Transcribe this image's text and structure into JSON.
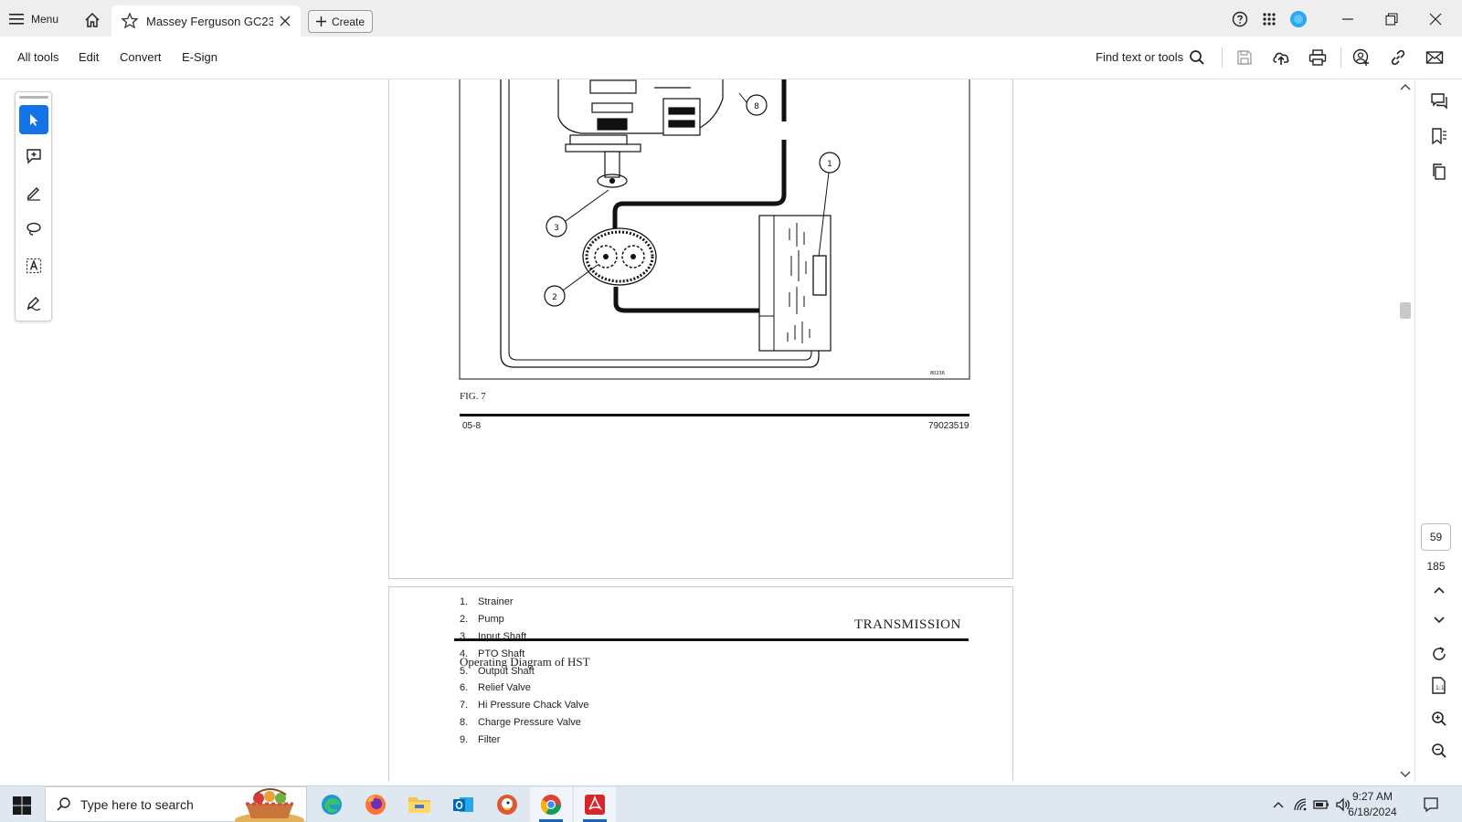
{
  "tabbar": {
    "menu_label": "Menu",
    "tab_title": "Massey Ferguson GC23...",
    "create_label": "Create"
  },
  "toolbar": {
    "menu_items": [
      "All tools",
      "Edit",
      "Convert",
      "E-Sign"
    ],
    "find_label": "Find text or tools"
  },
  "document": {
    "figure_caption": "FIG. 7",
    "fig_code": "80236",
    "page_left_footer": "05-8",
    "page_right_footer": "79023519",
    "diagram_callouts": [
      "8",
      "1",
      "3",
      "2"
    ],
    "section_title": "TRANSMISSION",
    "subtitle": "Operating Diagram of HST",
    "legend": [
      {
        "num": "1.",
        "label": "Strainer"
      },
      {
        "num": "2.",
        "label": "Pump"
      },
      {
        "num": "3.",
        "label": "Input Shaft"
      },
      {
        "num": "4.",
        "label": "PTO Shaft"
      },
      {
        "num": "5.",
        "label": "Output Shaft"
      },
      {
        "num": "6.",
        "label": "Relief Valve"
      },
      {
        "num": "7.",
        "label": "Hi Pressure Chack Valve"
      },
      {
        "num": "8.",
        "label": "Charge Pressure Valve"
      },
      {
        "num": "9.",
        "label": "Filter"
      }
    ]
  },
  "navigation": {
    "current_page": "59",
    "total_pages": "185"
  },
  "taskbar": {
    "search_placeholder": "Type here to search",
    "time": "9:27 AM",
    "date": "6/18/2024"
  },
  "colors": {
    "accent": "#1473e6",
    "taskbar_bg": "#dfe8f1",
    "tabbar_bg": "#eeeeee"
  }
}
